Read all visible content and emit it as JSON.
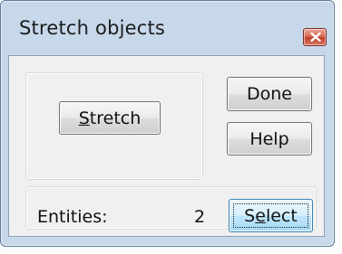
{
  "window": {
    "title": "Stretch objects"
  },
  "buttons": {
    "stretch": {
      "pre": "",
      "mnemonic": "S",
      "post": "tretch"
    },
    "done": {
      "label": "Done"
    },
    "help": {
      "label": "Help"
    },
    "select": {
      "pre": "S",
      "mnemonic": "e",
      "post": "lect"
    }
  },
  "status": {
    "entities_label": "Entities:",
    "entities_count": "2"
  },
  "colors": {
    "close_button": "#c7432d",
    "window_frame": "#c7d8eb",
    "focused_button_border": "#3c7fb1"
  },
  "icons": {
    "close": "close-x-icon"
  }
}
